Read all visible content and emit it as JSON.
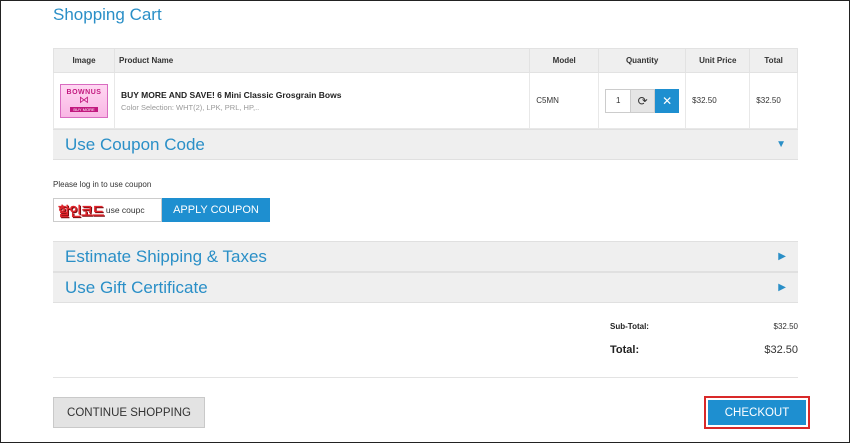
{
  "page": {
    "title": "Shopping Cart"
  },
  "table": {
    "headers": [
      "Image",
      "Product Name",
      "Model",
      "Quantity",
      "Unit Price",
      "Total"
    ],
    "item": {
      "thumb_title": "BOWNUS",
      "thumb_sub": "BUY MORE",
      "name": "BUY MORE AND SAVE! 6 Mini Classic Grosgrain Bows",
      "options": "Color Selection: WHT(2), LPK, PRL, HP,..",
      "model": "C5MN",
      "quantity": "1",
      "unit_price": "$32.50",
      "total": "$32.50"
    }
  },
  "coupon": {
    "panel_title": "Use Coupon Code",
    "note": "Please log in to use coupon",
    "badge_text": "할인코드",
    "input_placeholder": "use coupc",
    "apply_label": "APPLY COUPON"
  },
  "shipping": {
    "panel_title": "Estimate Shipping & Taxes"
  },
  "gift": {
    "panel_title": "Use Gift Certificate"
  },
  "totals": {
    "subtotal_label": "Sub-Total:",
    "subtotal_value": "$32.50",
    "total_label": "Total:",
    "total_value": "$32.50"
  },
  "actions": {
    "continue_label": "CONTINUE SHOPPING",
    "checkout_label": "CHECKOUT"
  },
  "colors": {
    "accent": "#2a8fc7",
    "button_blue": "#1e8fd0",
    "highlight_red": "#d92929"
  },
  "icons": {
    "refresh": "refresh-icon",
    "remove": "close-icon",
    "expand": "caret-down-icon",
    "collapse": "caret-right-icon"
  }
}
